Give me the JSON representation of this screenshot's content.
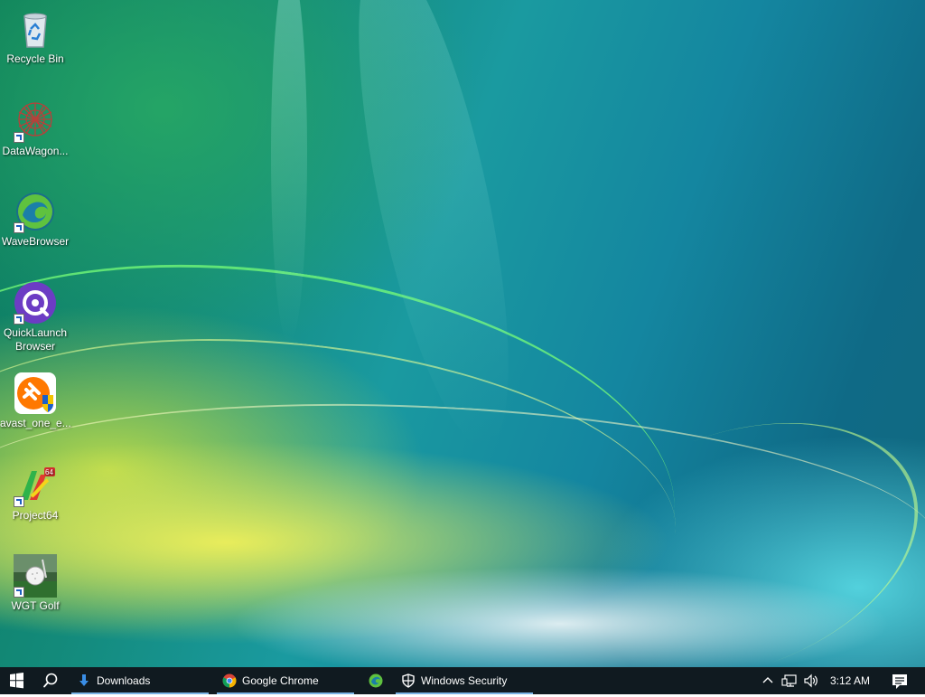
{
  "desktop": {
    "icons": [
      {
        "name": "recycle-bin",
        "label": "Recycle Bin"
      },
      {
        "name": "datawagon",
        "label": "DataWagon..."
      },
      {
        "name": "wavebrowser",
        "label": "WaveBrowser"
      },
      {
        "name": "quicklaunch-browser",
        "label": "QuickLaunch Browser"
      },
      {
        "name": "avast-one",
        "label": "avast_one_e..."
      },
      {
        "name": "project64",
        "label": "Project64"
      },
      {
        "name": "wgt-golf",
        "label": "WGT Golf"
      }
    ]
  },
  "taskbar": {
    "apps": [
      {
        "label": "Downloads",
        "icon": "download-arrow-icon"
      },
      {
        "label": "Google Chrome",
        "icon": "chrome-icon"
      },
      {
        "label": "",
        "icon": "wavebrowser-icon"
      },
      {
        "label": "Windows Security",
        "icon": "shield-icon"
      }
    ],
    "clock": "3:12 AM"
  },
  "colors": {
    "taskbar_bg": "#101a20",
    "active_indicator": "#7ab4e6",
    "accent": "#1d5fbf"
  }
}
